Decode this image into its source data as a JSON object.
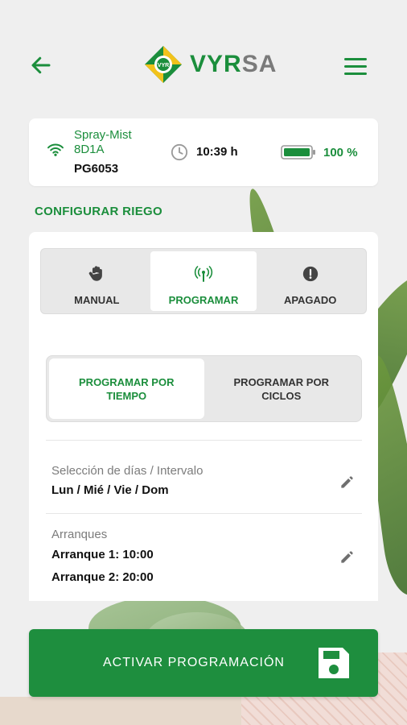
{
  "brand": {
    "name_part1": "VYR",
    "name_part2": "SA",
    "badge": "VYR",
    "accent": "#1b8e3c"
  },
  "header": {
    "back_icon": "arrow-left-icon",
    "menu_icon": "hamburger-icon"
  },
  "status": {
    "device_name": "Spray-Mist 8D1A",
    "device_id": "PG6053",
    "time": "10:39 h",
    "battery": "100 %",
    "battery_level": 1.0
  },
  "section_title": "CONFIGURAR RIEGO",
  "modes": [
    {
      "label": "MANUAL",
      "icon": "hand-icon"
    },
    {
      "label": "PROGRAMAR",
      "icon": "antenna-icon",
      "active": true
    },
    {
      "label": "APAGADO",
      "icon": "alert-icon"
    }
  ],
  "program_type": [
    {
      "label": "PROGRAMAR POR TIEMPO",
      "active": true
    },
    {
      "label": "PROGRAMAR POR CICLOS"
    }
  ],
  "days": {
    "label": "Selección de días / Intervalo",
    "value": "Lun / Mié / Vie / Dom"
  },
  "starts": {
    "label": "Arranques",
    "values": [
      "Arranque 1: 10:00",
      "Arranque 2: 20:00"
    ]
  },
  "action": {
    "label": "ACTIVAR PROGRAMACIÓN",
    "icon": "save-icon"
  }
}
